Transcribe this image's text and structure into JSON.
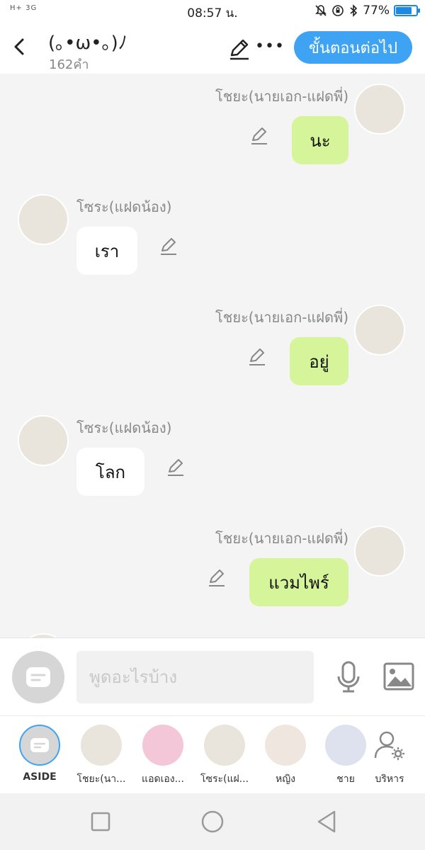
{
  "status_bar": {
    "signal": "H+ 3G",
    "time": "08:57 น.",
    "battery": "77%",
    "battery_level": 0.77
  },
  "header": {
    "title": "(｡•ω•｡)ﾉ",
    "word_count": "162คำ",
    "next_button": "ขั้นตอนต่อไป"
  },
  "messages": [
    {
      "side": "right",
      "sender": "โชยะ(นายเอก-แฝดพี่)",
      "text": "นะ"
    },
    {
      "side": "left",
      "sender": "โซระ(แฝดน้อง)",
      "text": "เรา"
    },
    {
      "side": "right",
      "sender": "โชยะ(นายเอก-แฝดพี่)",
      "text": "อยู่"
    },
    {
      "side": "left",
      "sender": "โซระ(แฝดน้อง)",
      "text": "โลก"
    },
    {
      "side": "right",
      "sender": "โชยะ(นายเอก-แฝดพี่)",
      "text": "แวมไพร์"
    }
  ],
  "input": {
    "placeholder": "พูดอะไรบ้าง"
  },
  "characters": [
    {
      "label": "ASIDE"
    },
    {
      "label": "โชยะ(นา..."
    },
    {
      "label": "แอดเอง..."
    },
    {
      "label": "โซระ(แฝ..."
    },
    {
      "label": "หญิง"
    },
    {
      "label": "ชาย"
    },
    {
      "label": "บริหาร"
    }
  ],
  "colors": {
    "accent": "#3fa3f3",
    "bubble_self": "#d6f59a",
    "bubble_other": "#ffffff",
    "background": "#f4f4f4"
  }
}
